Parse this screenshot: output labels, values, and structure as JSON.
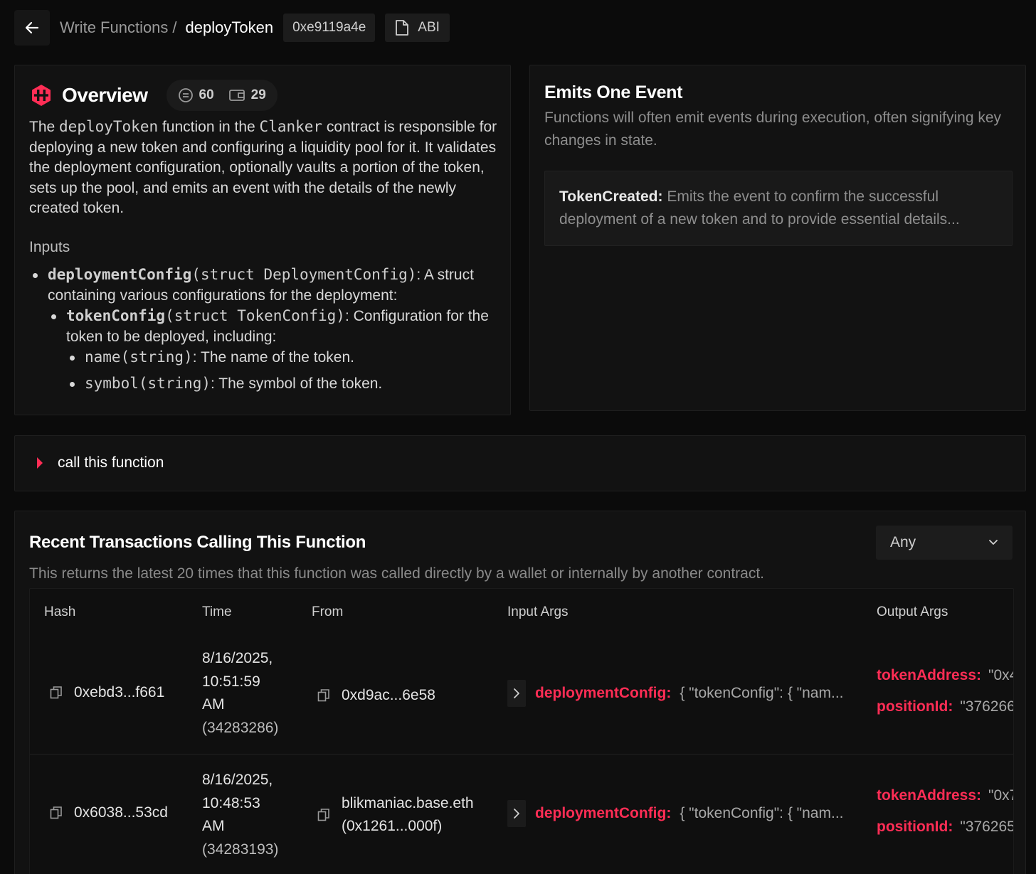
{
  "header": {
    "breadcrumb_parent": "Write Functions",
    "breadcrumb_sep": "/",
    "breadcrumb_current": "deployToken",
    "selector_chip": "0xe9119a4e",
    "abi_label": "ABI"
  },
  "overview": {
    "title": "Overview",
    "stat1": "60",
    "stat2": "29",
    "desc_part1": "The ",
    "desc_code1": "deployToken",
    "desc_part2": " function in the ",
    "desc_code2": "Clanker",
    "desc_part3": " contract is responsible for deploying a new token and configuring a liquidity pool for it. It validates the deployment configuration, optionally vaults a portion of the token, sets up the pool, and emits an event with the details of the newly created token.",
    "inputs_heading": "Inputs",
    "input1_name": "deploymentConfig",
    "input1_type": "(struct DeploymentConfig)",
    "input1_desc": ": A struct containing various configurations for the deployment:",
    "input1a_name": "tokenConfig",
    "input1a_type": "(struct TokenConfig)",
    "input1a_desc": ": Configuration for the token to be deployed, including:",
    "field1_name": "name",
    "field1_type": "(string)",
    "field1_desc": ": The name of the token.",
    "field2_name": "symbol",
    "field2_type": "(string)",
    "field2_desc": ": The symbol of the token."
  },
  "events": {
    "title": "Emits One Event",
    "description": "Functions will often emit events during execution, often signifying key changes in state.",
    "event_name": "TokenCreated:",
    "event_desc": " Emits the event to confirm the successful deployment of a new token and to provide essential details..."
  },
  "call": {
    "label": "call this function"
  },
  "transactions": {
    "title": "Recent Transactions Calling This Function",
    "description": "This returns the latest 20 times that this function was called directly by a wallet or internally by another contract.",
    "filter_value": "Any",
    "columns": {
      "hash": "Hash",
      "time": "Time",
      "from": "From",
      "input": "Input Args",
      "output": "Output Args"
    },
    "rows": [
      {
        "hash": "0xebd3...f661",
        "date": "8/16/2025,",
        "clock": "10:51:59",
        "ampm": "AM",
        "block": "(34283286)",
        "from_line1": "0xd9ac...6e58",
        "from_line2": "",
        "input_key": "deploymentConfig:",
        "input_val": "{ \"tokenConfig\": { \"nam...",
        "out1_key": "tokenAddress:",
        "out1_val": "\"0x4",
        "out2_key": "positionId:",
        "out2_val": "\"376266"
      },
      {
        "hash": "0x6038...53cd",
        "date": "8/16/2025,",
        "clock": "10:48:53",
        "ampm": "AM",
        "block": "(34283193)",
        "from_line1": "blikmaniac.base.eth",
        "from_line2": "(0x1261...000f)",
        "input_key": "deploymentConfig:",
        "input_val": "{ \"tokenConfig\": { \"nam...",
        "out1_key": "tokenAddress:",
        "out1_val": "\"0x7",
        "out2_key": "positionId:",
        "out2_val": "\"376265"
      }
    ]
  },
  "colors": {
    "accent": "#ff2d55",
    "background": "#0b0b0b",
    "panel": "#121212"
  },
  "icons": {
    "back": "arrow-left-icon",
    "abi": "document-icon",
    "logo": "clanker-logo-icon",
    "stat1": "coin-icon",
    "stat2": "wallet-icon",
    "call": "caret-right-icon",
    "select": "chevron-down-icon",
    "copy": "copy-icon",
    "expand": "chevron-right-icon"
  }
}
